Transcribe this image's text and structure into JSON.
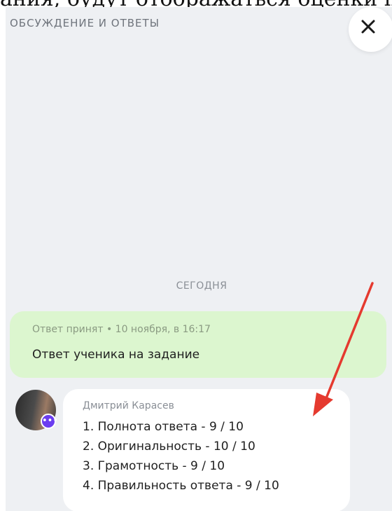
{
  "page_top_text": "ания, будут отображаться оценки по к",
  "header": {
    "title": "ОБСУЖДЕНИЕ И ОТВЕТЫ",
    "close_icon": "close-icon"
  },
  "chat": {
    "date_divider": "СЕГОДНЯ",
    "accepted_message": {
      "status": "Ответ принят • 10 ноября, в 16:17",
      "text": "Ответ ученика на задание"
    },
    "grade_message": {
      "author": "Дмитрий Карасев",
      "avatar_badge_icon": "more-dots-icon",
      "lines": [
        "1. Полнота ответа - 9   / 10",
        "2. Оригинальность - 10   / 10",
        "3. Грамотность - 9   / 10",
        "4. Правильность ответа - 9   / 10"
      ]
    }
  },
  "colors": {
    "panel_bg": "#eef0f3",
    "accepted_bubble": "#dcf6cf",
    "badge": "#6b3df0",
    "annotation_arrow": "#e53a2f"
  }
}
